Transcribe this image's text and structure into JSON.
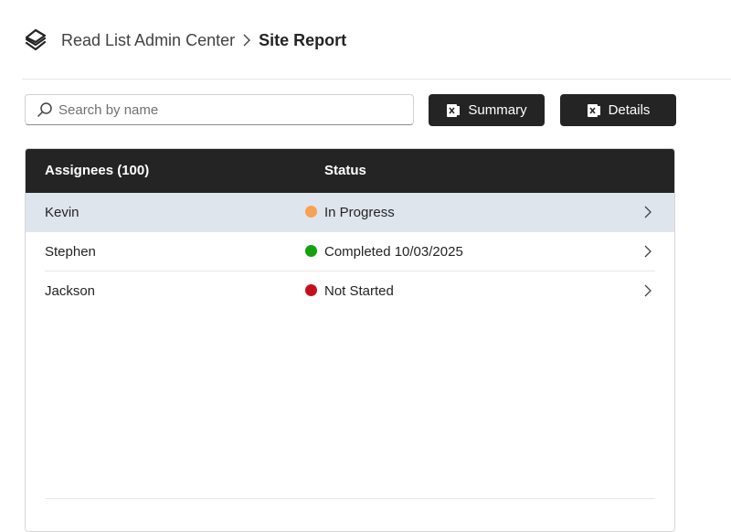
{
  "header": {
    "logo_icon": "layers-logo-icon",
    "breadcrumb_root": "Read List Admin Center",
    "breadcrumb_current": "Site Report"
  },
  "toolbar": {
    "search_placeholder": "Search by name",
    "search_value": "",
    "summary_label": "Summary",
    "details_label": "Details"
  },
  "table": {
    "col_assignees": "Assignees (100)",
    "col_status": "Status",
    "rows": [
      {
        "name": "Kevin",
        "status": "In Progress",
        "status_color": "#F7A155",
        "selected": true
      },
      {
        "name": "Stephen",
        "status": "Completed 10/03/2025",
        "status_color": "#13A10E",
        "selected": false
      },
      {
        "name": "Jackson",
        "status": "Not Started",
        "status_color": "#C50F1F",
        "selected": false
      }
    ]
  },
  "colors": {
    "header_bg": "#242424",
    "button_bg": "#242424",
    "selected_row": "#DFE5ED"
  }
}
